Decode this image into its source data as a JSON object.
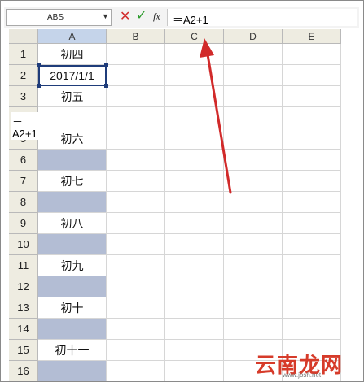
{
  "formula_bar": {
    "name_box": "ABS",
    "dropdown_icon": "chevron-down-icon",
    "cancel_icon": "cancel-x-icon",
    "enter_icon": "check-icon",
    "fx_label": "fx",
    "formula": "＝A2+1"
  },
  "columns": [
    "A",
    "B",
    "C",
    "D",
    "E"
  ],
  "rows": [
    {
      "num": "1",
      "a": "初四",
      "shaded": false
    },
    {
      "num": "2",
      "a": "2017/1/1",
      "shaded": false
    },
    {
      "num": "3",
      "a": "初五",
      "shaded": false
    },
    {
      "num": "4",
      "a": "＝A2+1",
      "shaded": false
    },
    {
      "num": "5",
      "a": "初六",
      "shaded": false
    },
    {
      "num": "6",
      "a": "",
      "shaded": true
    },
    {
      "num": "7",
      "a": "初七",
      "shaded": false
    },
    {
      "num": "8",
      "a": "",
      "shaded": true
    },
    {
      "num": "9",
      "a": "初八",
      "shaded": false
    },
    {
      "num": "10",
      "a": "",
      "shaded": true
    },
    {
      "num": "11",
      "a": "初九",
      "shaded": false
    },
    {
      "num": "12",
      "a": "",
      "shaded": true
    },
    {
      "num": "13",
      "a": "初十",
      "shaded": false
    },
    {
      "num": "14",
      "a": "",
      "shaded": true
    },
    {
      "num": "15",
      "a": "初十一",
      "shaded": false
    },
    {
      "num": "16",
      "a": "",
      "shaded": true
    }
  ],
  "watermark": {
    "text": "云南龙网",
    "url": "www.jbsh.net"
  },
  "colors": {
    "arrow": "#d12a2a",
    "shade": "#b3bdd4",
    "selection": "#1f3c7a"
  }
}
